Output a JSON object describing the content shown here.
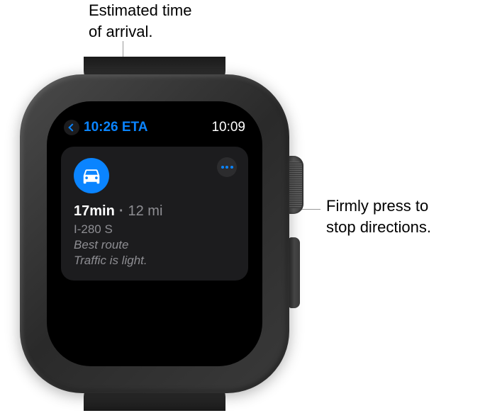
{
  "annotations": {
    "eta": "Estimated time\nof arrival.",
    "press": "Firmly press to\nstop directions."
  },
  "statusBar": {
    "eta": "10:26 ETA",
    "time": "10:09"
  },
  "route": {
    "duration": "17min",
    "distance": "12 mi",
    "road": "I-280 S",
    "bestRoute": "Best route",
    "traffic": "Traffic is light."
  }
}
